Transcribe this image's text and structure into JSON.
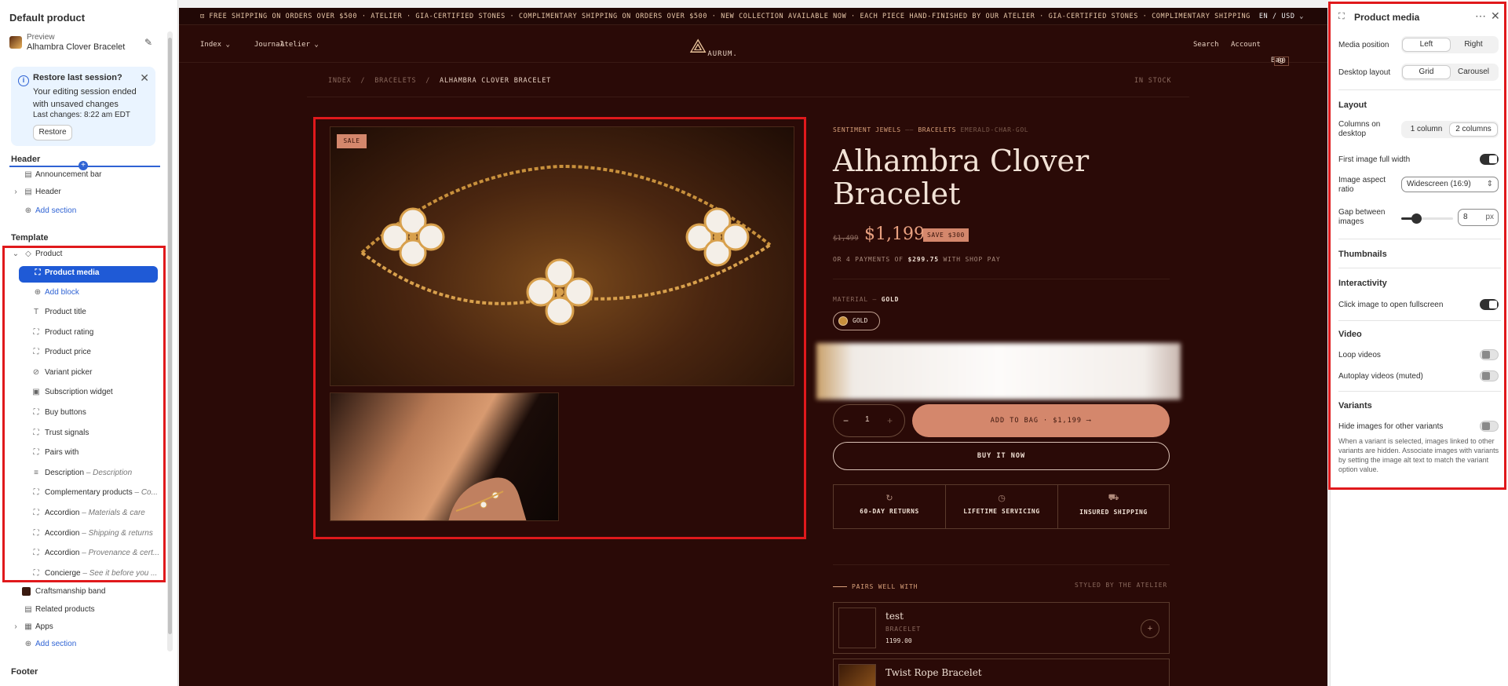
{
  "left": {
    "title": "Default product",
    "preview_label": "Preview",
    "preview_value": "Alhambra Clover Bracelet",
    "notice": {
      "title": "Restore last session?",
      "body": "Your editing session ended with unsaved changes",
      "last": "Last changes: 8:22 am EDT",
      "button": "Restore"
    },
    "header_section": "Header",
    "header_items": [
      "Announcement bar",
      "Header"
    ],
    "add_section": "Add section",
    "template_section": "Template",
    "product": "Product",
    "selected": "Product media",
    "add_block": "Add block",
    "blocks": [
      {
        "label": "Product title",
        "sub": ""
      },
      {
        "label": "Product rating",
        "sub": ""
      },
      {
        "label": "Product price",
        "sub": ""
      },
      {
        "label": "Variant picker",
        "sub": ""
      },
      {
        "label": "Subscription widget",
        "sub": ""
      },
      {
        "label": "Buy buttons",
        "sub": ""
      },
      {
        "label": "Trust signals",
        "sub": ""
      },
      {
        "label": "Pairs with",
        "sub": ""
      },
      {
        "label": "Description",
        "sub": "– Description"
      },
      {
        "label": "Complementary products",
        "sub": "– Co..."
      },
      {
        "label": "Accordion",
        "sub": "– Materials & care"
      },
      {
        "label": "Accordion",
        "sub": "– Shipping & returns"
      },
      {
        "label": "Accordion",
        "sub": "– Provenance & cert..."
      },
      {
        "label": "Concierge",
        "sub": "– See it before you ..."
      }
    ],
    "after_items": [
      "Craftsmanship band",
      "Related products",
      "Apps"
    ],
    "add_section_2": "Add section",
    "footer_section": "Footer"
  },
  "store": {
    "marquee": "⊡ FREE SHIPPING ON ORDERS OVER $500 · ATELIER · GIA-CERTIFIED STONES · COMPLIMENTARY SHIPPING ON ORDERS OVER $500 · NEW COLLECTION AVAILABLE NOW · EACH PIECE HAND-FINISHED BY OUR ATELIER · GIA-CERTIFIED STONES · COMPLIMENTARY SHIPPING",
    "currency": "EN / USD ⌄",
    "nav_left": [
      "Index ⌄",
      "Journal",
      "Atelier ⌄"
    ],
    "logo": "AURUM.",
    "nav_right": [
      "Search",
      "Account",
      "Bag"
    ],
    "bag_count": "00",
    "breadcrumb": [
      "INDEX",
      "BRACELETS",
      "ALHAMBRA CLOVER BRACELET"
    ],
    "stock": "IN STOCK",
    "sale_badge": "SALE",
    "vendor": "SENTIMENT JEWELS",
    "vendor_type": "BRACELETS",
    "vendor_sku": "EMERALD-CHAR-GOL",
    "title": "Alhambra Clover Bracelet",
    "compare_price": "$1,499",
    "price": "$1,199",
    "save": "SAVE $300",
    "payments": "OR 4 PAYMENTS OF",
    "payments_amount": "$299.75",
    "payments_suffix": "WITH SHOP PAY",
    "material_label": "MATERIAL —",
    "material_value": "GOLD",
    "swatch": "GOLD",
    "qty": "1",
    "add_to_bag": "ADD TO BAG · $1,199 ⟶",
    "buy_now": "BUY IT NOW",
    "trust": [
      {
        "icon": "↻",
        "label": "60-DAY RETURNS"
      },
      {
        "icon": "◷",
        "label": "LIFETIME SERVICING"
      },
      {
        "icon": "⛟",
        "label": "INSURED SHIPPING"
      }
    ],
    "pairs_title": "PAIRS WELL WITH",
    "styled": "STYLED BY THE ATELIER",
    "cards": [
      {
        "name": "test",
        "cat": "BRACELET",
        "price": "1199.00"
      },
      {
        "name": "Twist Rope Bracelet",
        "cat": "",
        "price": ""
      }
    ]
  },
  "right": {
    "title": "Product media",
    "media_position_label": "Media position",
    "media_position": [
      "Left",
      "Right"
    ],
    "desktop_layout_label": "Desktop layout",
    "desktop_layout": [
      "Grid",
      "Carousel"
    ],
    "layout_section": "Layout",
    "columns_label": "Columns on desktop",
    "columns": [
      "1 column",
      "2 columns"
    ],
    "first_full_label": "First image full width",
    "first_full": true,
    "aspect_label": "Image aspect ratio",
    "aspect_value": "Widescreen (16:9)",
    "gap_label": "Gap between images",
    "gap_value": "8",
    "gap_unit": "px",
    "thumbs_section": "Thumbnails",
    "interactivity_section": "Interactivity",
    "fullscreen_label": "Click image to open fullscreen",
    "fullscreen": true,
    "video_section": "Video",
    "loop_label": "Loop videos",
    "loop": false,
    "autoplay_label": "Autoplay videos (muted)",
    "autoplay": false,
    "variants_section": "Variants",
    "hide_label": "Hide images for other variants",
    "hide": false,
    "help": "When a variant is selected, images linked to other variants are hidden. Associate images with variants by setting the image alt text to match the variant option value."
  },
  "colors": {
    "accent": "#1f5ad6",
    "highlight": "#e0191c",
    "store_bg": "#2a0a07",
    "store_accent": "#d4876c"
  }
}
